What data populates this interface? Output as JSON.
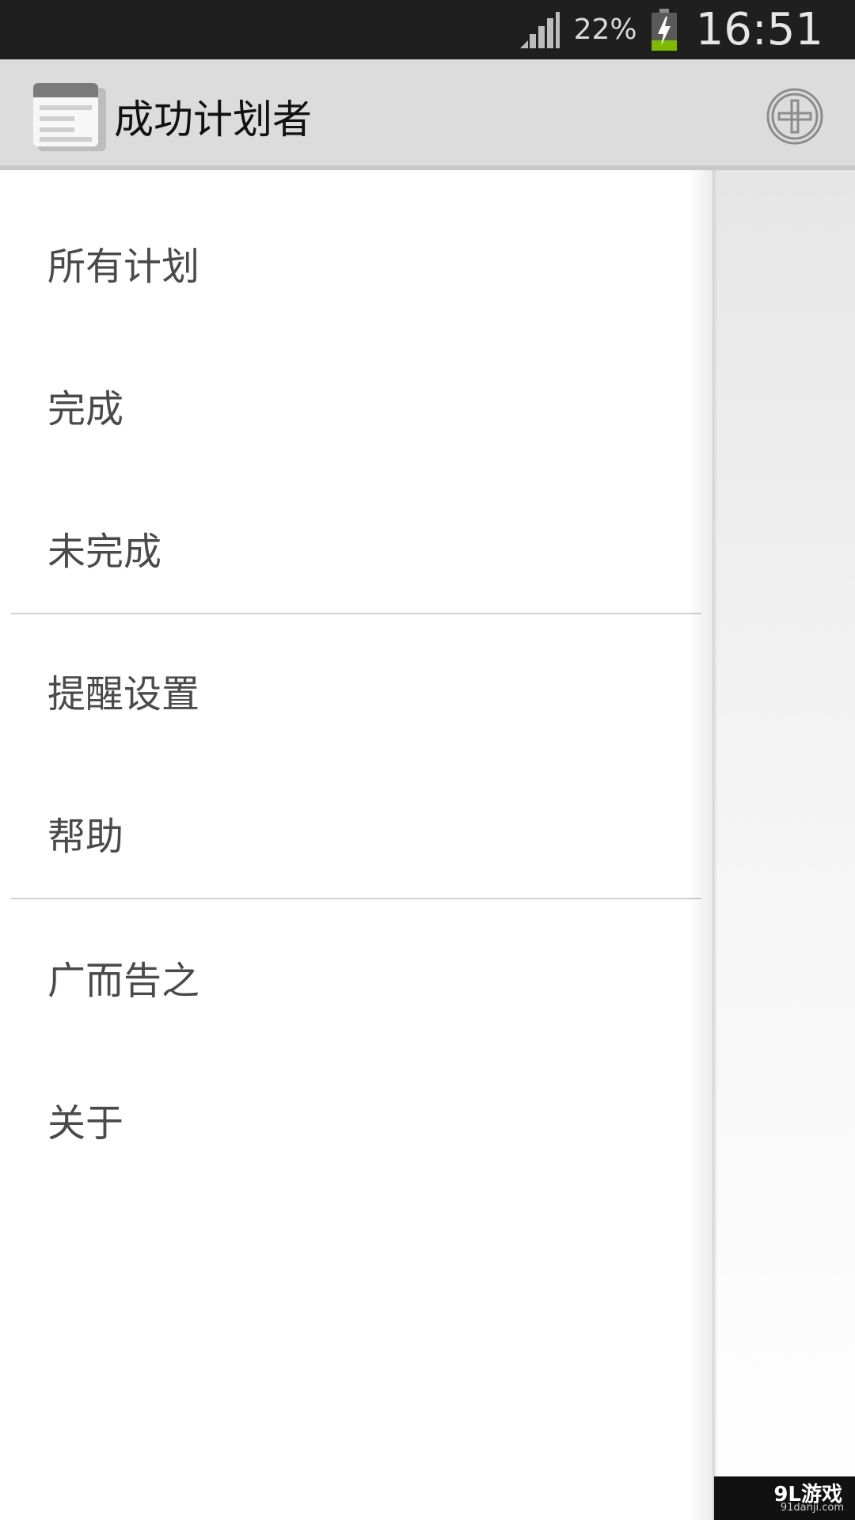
{
  "status_bar": {
    "battery_percent": "22%",
    "time": "16:51",
    "icons": {
      "signal": "signal-icon",
      "battery": "battery-charging-icon"
    },
    "battery_color": "#7fba00"
  },
  "action_bar": {
    "title": "成功计划者",
    "icons": {
      "app": "app-notes-icon",
      "add": "add-circle-icon"
    }
  },
  "drawer": {
    "items": [
      {
        "label": "所有计划"
      },
      {
        "label": "完成"
      },
      {
        "label": "未完成"
      },
      {
        "label": "提醒设置"
      },
      {
        "label": "帮助"
      },
      {
        "label": "广而告之"
      },
      {
        "label": "关于"
      }
    ]
  },
  "watermark": {
    "text": "9L游戏",
    "sub": "91danji.com"
  }
}
